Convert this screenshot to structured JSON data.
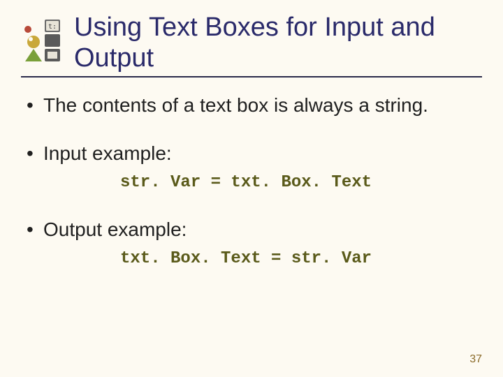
{
  "title": "Using Text Boxes for Input and Output",
  "bullets": [
    {
      "text": "The contents of a text box is always a string."
    },
    {
      "text": "Input example:",
      "code": "str. Var = txt. Box. Text"
    },
    {
      "text": "Output example:",
      "code": "txt. Box. Text = str. Var"
    }
  ],
  "page_number": "37",
  "icon_name": "ide-toolbox-logo"
}
